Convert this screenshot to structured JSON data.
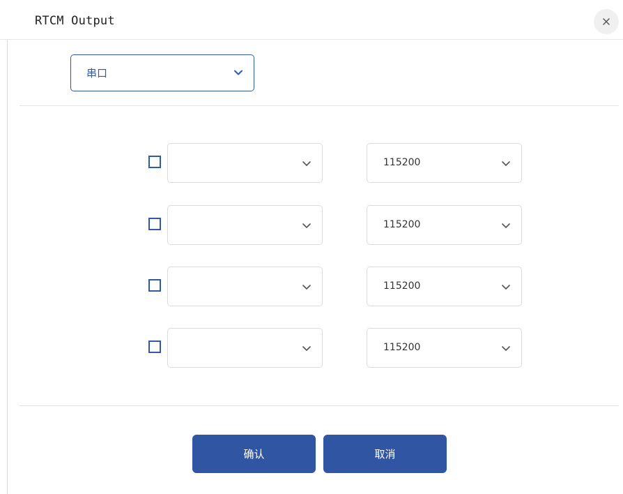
{
  "dialog": {
    "title": "RTCM Output",
    "close_icon": "close-icon"
  },
  "mode_select": {
    "value": "串口"
  },
  "rows": [
    {
      "checked": false,
      "port": "",
      "baud": "115200"
    },
    {
      "checked": false,
      "port": "",
      "baud": "115200"
    },
    {
      "checked": false,
      "port": "",
      "baud": "115200"
    },
    {
      "checked": false,
      "port": "",
      "baud": "115200"
    }
  ],
  "buttons": {
    "confirm_label": "确认",
    "cancel_label": "取消"
  },
  "colors": {
    "accent": "#2f55a3",
    "border": "#dcdcdc",
    "text": "#333333"
  }
}
